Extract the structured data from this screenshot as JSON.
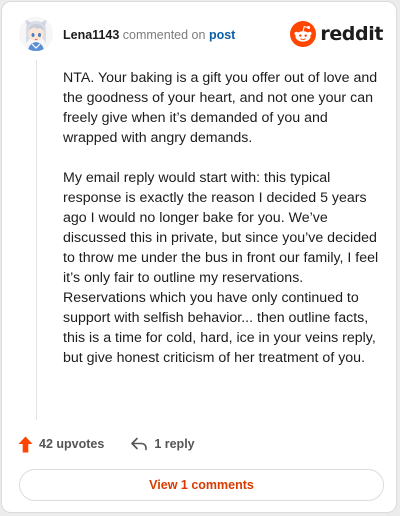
{
  "header": {
    "username": "Lena1143",
    "action_text": "commented on",
    "post_link": "post",
    "brand_name": "reddit"
  },
  "comment": {
    "paragraphs": [
      "NTA. Your baking is a gift you offer out of love and the goodness of your heart, and not one your can freely give when it’s demanded of you and wrapped with angry demands.",
      "My email reply would start with: this typical response is exactly the reason I decided 5 years ago I would no longer bake for you. We’ve discussed this in private, but since you’ve decided to throw me under the bus in front our family, I feel it’s only fair to outline my reservations. Reservations which you have only continued to support with selfish behavior... then outline facts, this is a time for cold, hard, ice in your veins reply, but give honest criticism of her treatment of you."
    ]
  },
  "actions": {
    "upvotes": "42 upvotes",
    "replies": "1 reply"
  },
  "footer": {
    "view_comments": "View 1 comments"
  },
  "colors": {
    "brand_orange": "#ff4500",
    "upvote_orange": "#ff4500",
    "link_blue": "#0b5fa8",
    "view_comments_text": "#d93a00"
  },
  "icons": {
    "avatar": "anime-character-avatar",
    "brand": "reddit-snoo-icon",
    "upvote": "upvote-arrow-icon",
    "reply": "reply-arrow-icon"
  }
}
